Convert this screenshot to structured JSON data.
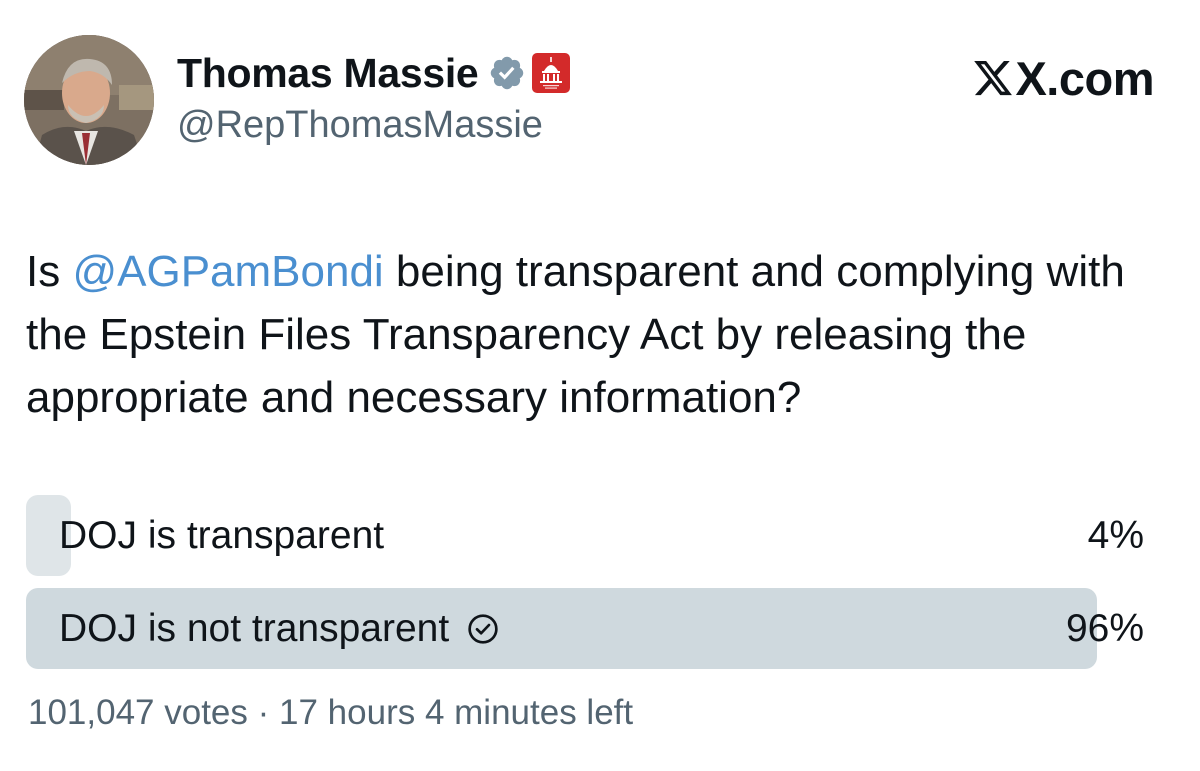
{
  "author": {
    "name": "Thomas Massie",
    "handle": "@RepThomasMassie",
    "verified_icon": "verified-badge-icon",
    "affiliation_icon": "capitol-dome-badge-icon"
  },
  "brand": {
    "text": "X.com"
  },
  "post": {
    "text_before": "Is ",
    "mention": "@AGPamBondi",
    "text_after": " being transparent and complying with the Epstein Files Transparency Act by releasing the appropriate and necessary information?"
  },
  "poll": {
    "options": [
      {
        "label": "DOJ is transparent",
        "percent_text": "4%",
        "percent": 4,
        "selected": false
      },
      {
        "label": "DOJ is not transparent",
        "percent_text": "96%",
        "percent": 96,
        "selected": true
      }
    ],
    "votes": "101,047 votes",
    "separator": "·",
    "time_left": "17 hours 4 minutes left"
  },
  "colors": {
    "mention": "#4a8fd0",
    "secondary_text": "#536471",
    "poll_fill": "#cfd9de",
    "verified": "#829aab",
    "affiliation_badge": "#d32a2a"
  }
}
